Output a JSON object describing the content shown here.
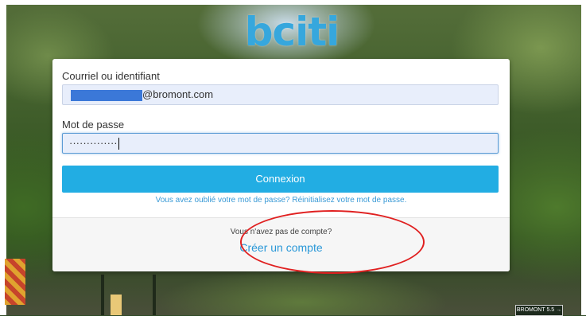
{
  "logo": {
    "text": "bciti"
  },
  "login": {
    "username_label": "Courriel ou identifiant",
    "username_value_suffix": "@bromont.com",
    "password_label": "Mot de passe",
    "password_value": "··············",
    "submit_label": "Connexion",
    "forgot_text": "Vous avez oublié votre mot de passe? Réinitialisez votre mot de passe."
  },
  "signup": {
    "prompt": "Vous n'avez pas de compte?",
    "link": "Créer un compte"
  },
  "street_sign": "BROMONT 5.5 →",
  "colors": {
    "accent": "#22ade3",
    "link": "#3a9ad6",
    "annotation": "#e02020",
    "redaction": "#3b78d8"
  }
}
